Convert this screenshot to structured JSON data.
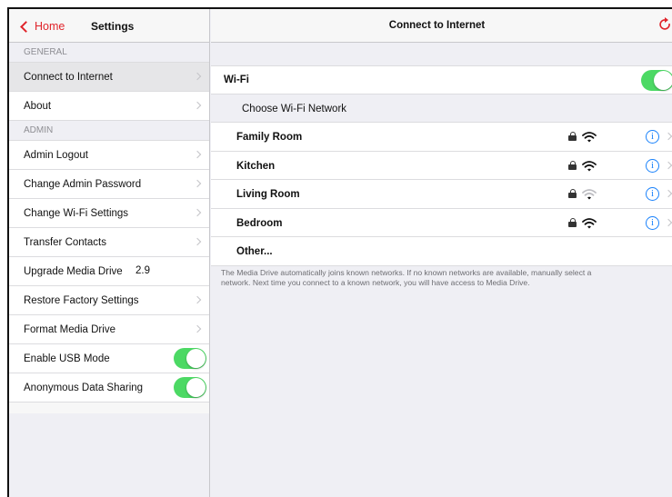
{
  "sidebar": {
    "back_label": "Home",
    "title": "Settings",
    "general_label": "GENERAL",
    "general_items": [
      {
        "label": "Connect to Internet",
        "selected": true
      },
      {
        "label": "About"
      }
    ],
    "admin_label": "ADMIN",
    "admin_items": [
      {
        "label": "Admin Logout"
      },
      {
        "label": "Change Admin Password"
      },
      {
        "label": "Change Wi-Fi Settings"
      },
      {
        "label": "Transfer Contacts"
      },
      {
        "label": "Upgrade Media Drive",
        "value": "2.9"
      },
      {
        "label": "Restore Factory Settings"
      },
      {
        "label": "Format Media Drive"
      },
      {
        "label": "Enable USB Mode",
        "toggle_on": true
      },
      {
        "label": "Anonymous Data Sharing",
        "toggle_on": true
      }
    ]
  },
  "main": {
    "title": "Connect to Internet",
    "wifi_label": "Wi-Fi",
    "wifi_on": true,
    "choose_label": "Choose Wi-Fi Network",
    "networks": [
      {
        "name": "Family Room",
        "signal": "strong",
        "locked": true
      },
      {
        "name": "Kitchen",
        "signal": "strong",
        "locked": true
      },
      {
        "name": "Living Room",
        "signal": "weak",
        "locked": true
      },
      {
        "name": "Bedroom",
        "signal": "strong",
        "locked": true
      }
    ],
    "other_label": "Other...",
    "footnote": "The Media Drive automatically joins known networks. If no known networks are available, manually select a\nnetwork. Next time you connect to a known network, you will have access to Media Drive."
  },
  "colors": {
    "accent_red": "#e0242b",
    "toggle_green": "#4cd964",
    "info_blue": "#1a82fb"
  },
  "icons": {
    "back": "chevron-left-icon",
    "refresh": "refresh-icon",
    "lock": "lock-icon",
    "wifi": "wifi-icon",
    "info": "info-icon",
    "disclosure": "chevron-right-icon"
  }
}
